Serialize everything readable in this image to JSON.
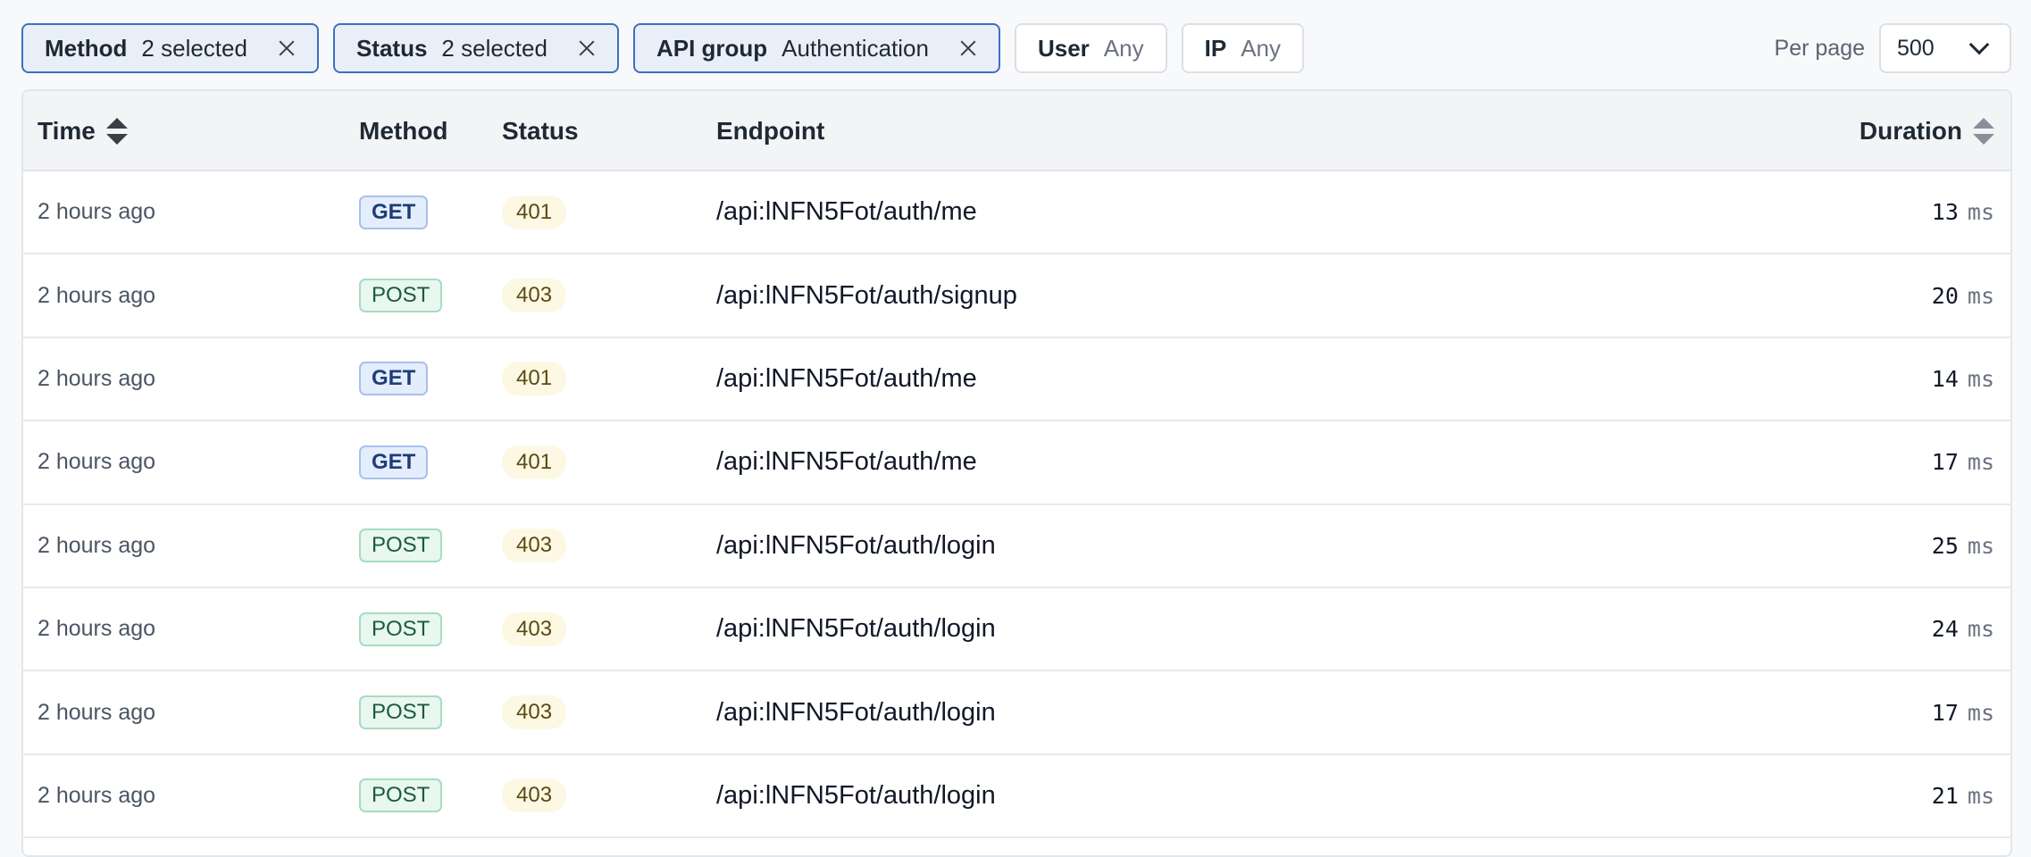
{
  "filters": [
    {
      "name": "Method",
      "value": "2 selected",
      "active": true
    },
    {
      "name": "Status",
      "value": "2 selected",
      "active": true
    },
    {
      "name": "API group",
      "value": "Authentication",
      "active": true
    },
    {
      "name": "User",
      "value": "Any",
      "active": false
    },
    {
      "name": "IP",
      "value": "Any",
      "active": false
    }
  ],
  "per_page": {
    "label": "Per page",
    "value": "500"
  },
  "table": {
    "headers": {
      "time": "Time",
      "method": "Method",
      "status": "Status",
      "endpoint": "Endpoint",
      "duration": "Duration"
    },
    "unit": "ms",
    "rows": [
      {
        "time": "2 hours ago",
        "method": "GET",
        "status": "401",
        "endpoint": "/api:lNFN5Fot/auth/me",
        "duration": "13"
      },
      {
        "time": "2 hours ago",
        "method": "POST",
        "status": "403",
        "endpoint": "/api:lNFN5Fot/auth/signup",
        "duration": "20"
      },
      {
        "time": "2 hours ago",
        "method": "GET",
        "status": "401",
        "endpoint": "/api:lNFN5Fot/auth/me",
        "duration": "14"
      },
      {
        "time": "2 hours ago",
        "method": "GET",
        "status": "401",
        "endpoint": "/api:lNFN5Fot/auth/me",
        "duration": "17"
      },
      {
        "time": "2 hours ago",
        "method": "POST",
        "status": "403",
        "endpoint": "/api:lNFN5Fot/auth/login",
        "duration": "25"
      },
      {
        "time": "2 hours ago",
        "method": "POST",
        "status": "403",
        "endpoint": "/api:lNFN5Fot/auth/login",
        "duration": "24"
      },
      {
        "time": "2 hours ago",
        "method": "POST",
        "status": "403",
        "endpoint": "/api:lNFN5Fot/auth/login",
        "duration": "17"
      },
      {
        "time": "2 hours ago",
        "method": "POST",
        "status": "403",
        "endpoint": "/api:lNFN5Fot/auth/login",
        "duration": "21"
      }
    ]
  }
}
